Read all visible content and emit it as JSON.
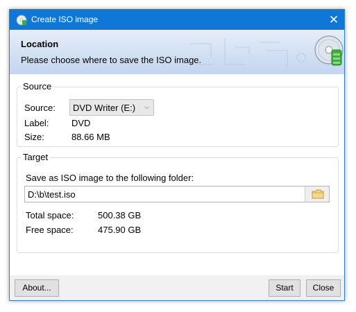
{
  "window": {
    "title": "Create ISO image",
    "close_glyph": "✕"
  },
  "banner": {
    "title": "Location",
    "subtitle": "Please choose where to save the ISO image.",
    "icon": "cd-disc-icon"
  },
  "source": {
    "legend": "Source",
    "source_label": "Source:",
    "source_value": "DVD Writer (E:)",
    "label_label": "Label:",
    "label_value": "DVD",
    "size_label": "Size:",
    "size_value": "88.66 MB"
  },
  "target": {
    "legend": "Target",
    "instruction": "Save as ISO image to the following folder:",
    "path_value": "D:\\b\\test.iso",
    "browse_icon": "folder-icon",
    "total_label": "Total space:",
    "total_value": "500.38 GB",
    "free_label": "Free space:",
    "free_value": "475.90 GB"
  },
  "footer": {
    "about_label": "About...",
    "start_label": "Start",
    "close_label": "Close"
  },
  "colors": {
    "titlebar": "#0f78d7",
    "window_border": "#2b7bd0",
    "banner_top": "#e6eef9",
    "banner_bottom": "#c3d5ef",
    "disc_accent": "#3fae3a"
  }
}
